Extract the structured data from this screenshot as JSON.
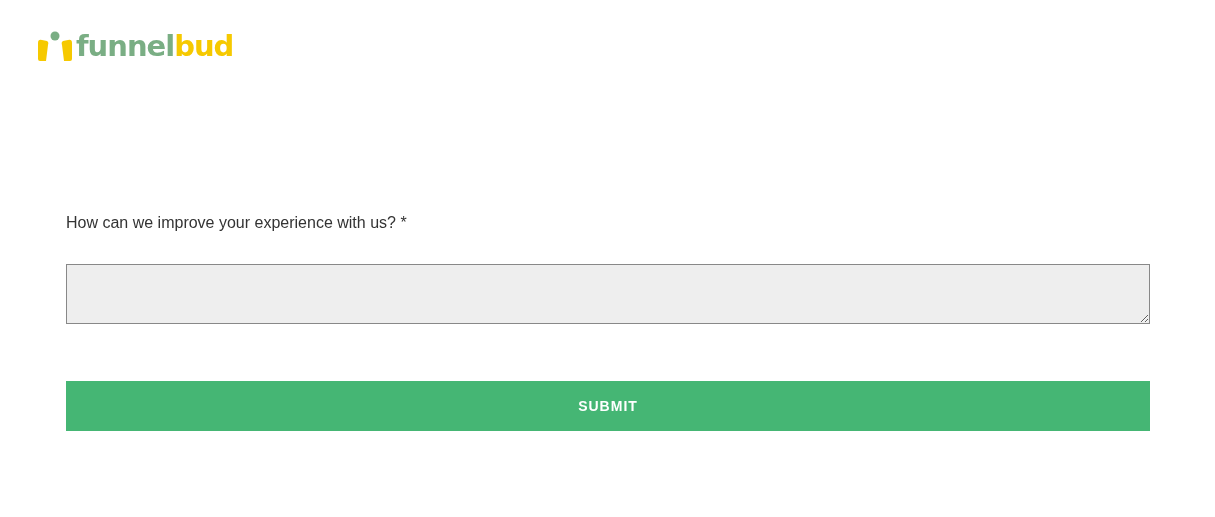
{
  "logo": {
    "parts": [
      {
        "text": "funnel",
        "color": "#7aae84"
      },
      {
        "text": "bud",
        "color": "#f6c900"
      }
    ]
  },
  "form": {
    "question": "How can we improve your experience with us? *",
    "button": "SUBMIT"
  }
}
